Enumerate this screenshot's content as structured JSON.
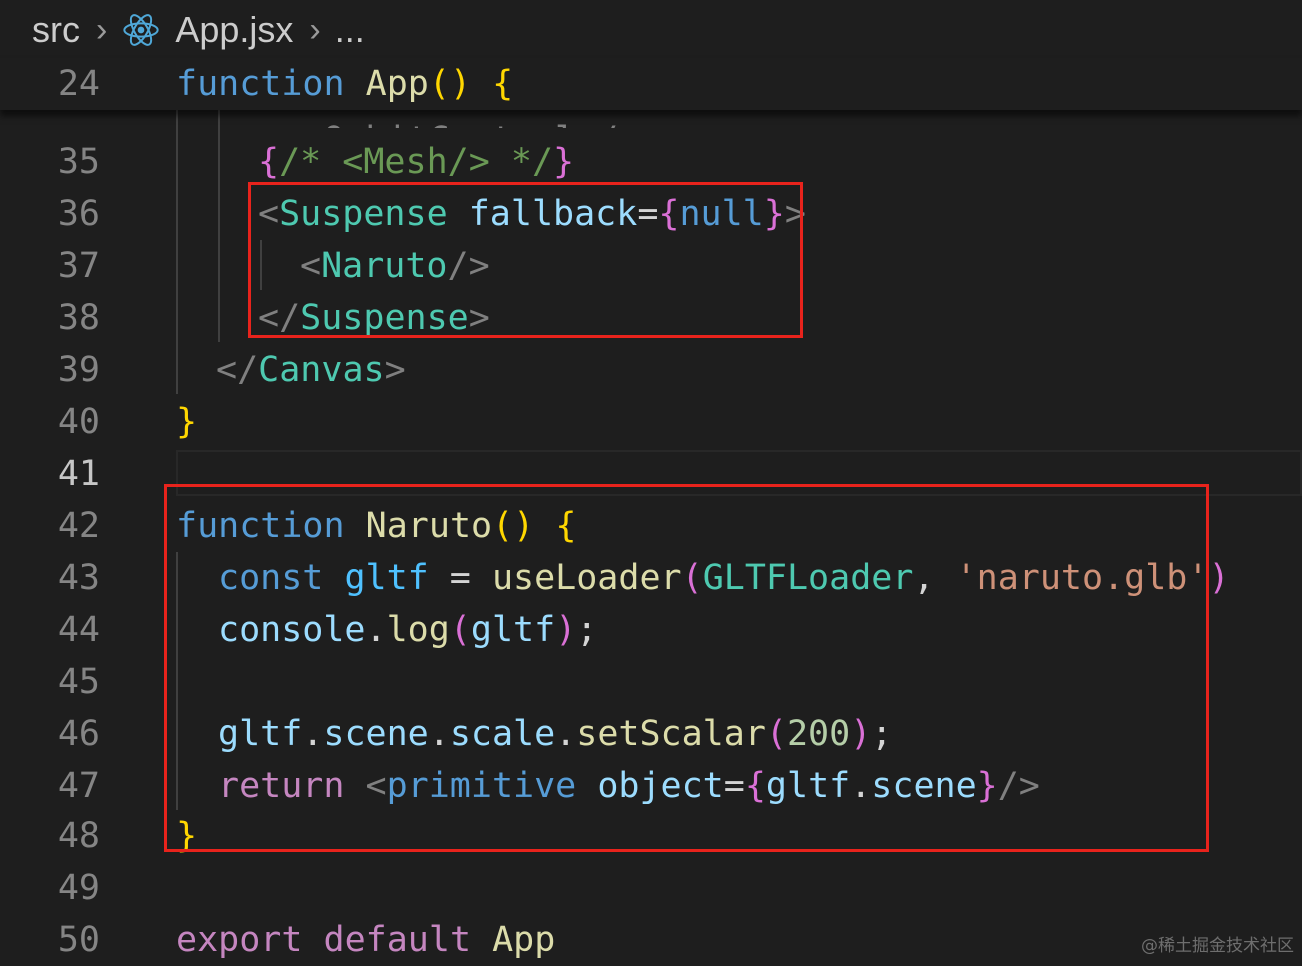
{
  "breadcrumb": {
    "folder": "src",
    "file": "App.jsx",
    "ellipsis": "...",
    "icon": "react-icon"
  },
  "sticky": {
    "line_number": "24",
    "keyword": "function",
    "name": "App",
    "parens": "()",
    "brace": "{"
  },
  "cut_line_text": "<OrbitControls/>",
  "lines": {
    "l35": {
      "n": "35"
    },
    "l36": {
      "n": "36"
    },
    "l37": {
      "n": "37"
    },
    "l38": {
      "n": "38"
    },
    "l39": {
      "n": "39"
    },
    "l40": {
      "n": "40"
    },
    "l41": {
      "n": "41"
    },
    "l42": {
      "n": "42"
    },
    "l43": {
      "n": "43"
    },
    "l44": {
      "n": "44"
    },
    "l45": {
      "n": "45"
    },
    "l46": {
      "n": "46"
    },
    "l47": {
      "n": "47"
    },
    "l48": {
      "n": "48"
    },
    "l49": {
      "n": "49"
    },
    "l50": {
      "n": "50"
    }
  },
  "tokens": {
    "open_brace": "{",
    "close_brace": "}",
    "comment": "/* <Mesh/> */",
    "lt": "<",
    "lt_slash": "</",
    "gt": ">",
    "self_close": "/>",
    "suspense": "Suspense",
    "fallback": "fallback",
    "eq": "=",
    "null": "null",
    "naruto": "Naruto",
    "canvas": "Canvas",
    "function": "function",
    "parens_open": "(",
    "parens_close": ")",
    "const": "const",
    "gltf": "gltf",
    "assign": " = ",
    "useLoader": "useLoader",
    "GLTFLoader": "GLTFLoader",
    "comma": ", ",
    "string": "'naruto.glb'",
    "console": "console",
    "dot": ".",
    "log": "log",
    "semicolon": ";",
    "scene": "scene",
    "scale": "scale",
    "setScalar": "setScalar",
    "num200": "200",
    "return": "return",
    "primitive": "primitive",
    "object": "object",
    "export": "export",
    "default": "default",
    "App": "App"
  },
  "watermark": "@稀土掘金技术社区",
  "colors": {
    "background": "#1e1e1e",
    "highlight_box": "#e8231c",
    "keyword": "#569cd6",
    "function_name": "#dcdcaa",
    "component": "#4ec9b0",
    "string": "#ce9178",
    "control": "#c586c0"
  }
}
